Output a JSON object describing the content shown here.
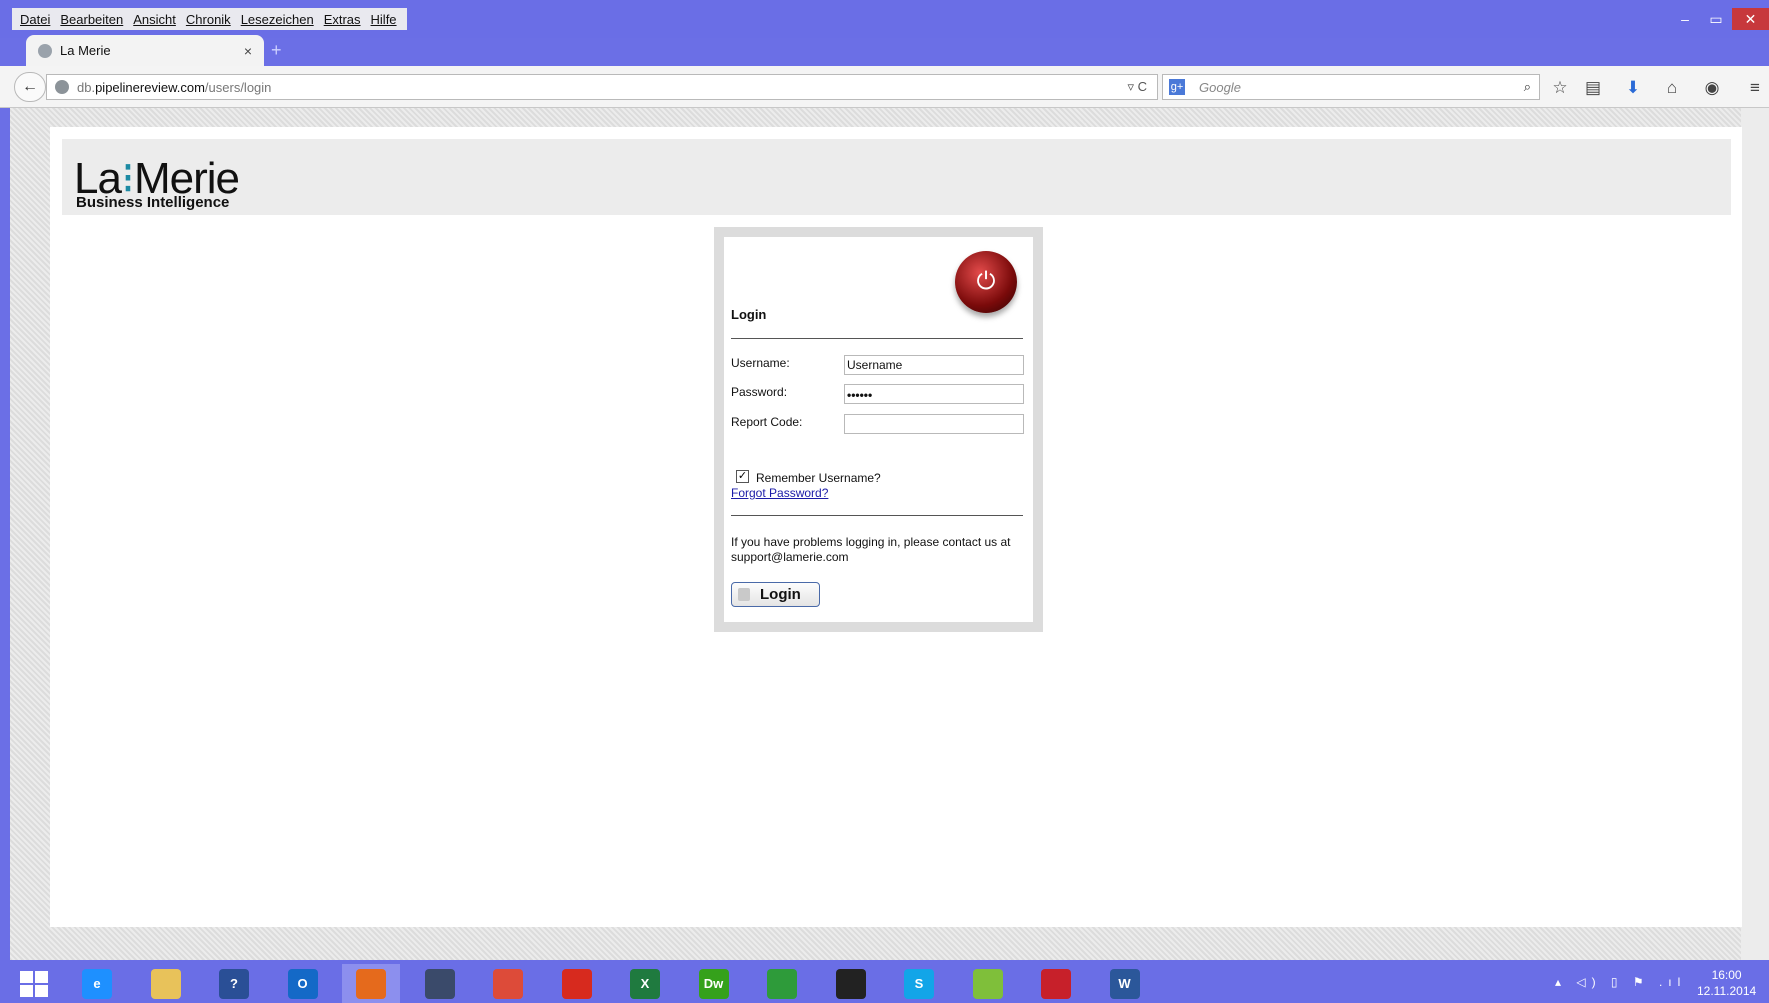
{
  "menu": [
    "Datei",
    "Bearbeiten",
    "Ansicht",
    "Chronik",
    "Lesezeichen",
    "Extras",
    "Hilfe"
  ],
  "window_controls": {
    "minimize": "–",
    "maximize": "▭",
    "close": "✕"
  },
  "tab": {
    "title": "La Merie",
    "close": "×",
    "new_tab": "+"
  },
  "address": {
    "domain_prefix": "db.",
    "domain": "pipelinereview.com",
    "path": "/users/login"
  },
  "search": {
    "engine_icon": "g+",
    "placeholder": "Google"
  },
  "logo": {
    "text_1": "La",
    "dots": "⁝",
    "text_2": "Merie",
    "subtitle": "Business Intelligence"
  },
  "login": {
    "title": "Login",
    "username_label": "Username:",
    "username_value": "Username",
    "password_label": "Password:",
    "password_value": "••••••",
    "report_code_label": "Report Code:",
    "report_code_value": "",
    "remember_label": "Remember Username?",
    "remember_checked": true,
    "forgot_link": "Forgot Password?",
    "problem_text": "If you have problems logging in, please contact us at support@lamerie.com",
    "button_label": "Login"
  },
  "taskbar_apps": [
    {
      "name": "internet-explorer",
      "label": "e",
      "color": "#1e90ff"
    },
    {
      "name": "file-explorer",
      "label": "",
      "color": "#e8c25a"
    },
    {
      "name": "help",
      "label": "?",
      "color": "#2a4f96"
    },
    {
      "name": "outlook",
      "label": "O",
      "color": "#1469c7"
    },
    {
      "name": "firefox",
      "label": "",
      "color": "#e56a1c"
    },
    {
      "name": "globe-app",
      "label": "",
      "color": "#3a4a6a"
    },
    {
      "name": "chrome",
      "label": "",
      "color": "#dd4b39"
    },
    {
      "name": "acrobat",
      "label": "",
      "color": "#d72a1e"
    },
    {
      "name": "excel",
      "label": "X",
      "color": "#1f7a3f"
    },
    {
      "name": "dreamweaver",
      "label": "Dw",
      "color": "#35a11b"
    },
    {
      "name": "store",
      "label": "",
      "color": "#2e9b3a"
    },
    {
      "name": "steam-app",
      "label": "",
      "color": "#222222"
    },
    {
      "name": "skype",
      "label": "S",
      "color": "#12a5e8"
    },
    {
      "name": "bluestacks",
      "label": "",
      "color": "#7fbf3a"
    },
    {
      "name": "expressvpn",
      "label": "",
      "color": "#c7202a"
    },
    {
      "name": "word",
      "label": "W",
      "color": "#2b579a"
    }
  ],
  "clock": {
    "time": "16:00",
    "date": "12.11.2014"
  }
}
